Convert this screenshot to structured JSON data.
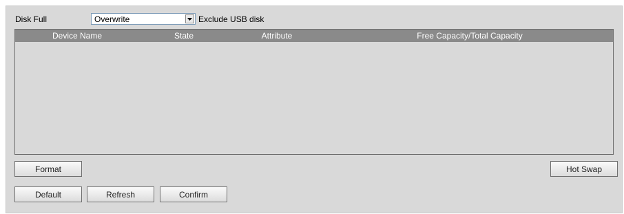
{
  "disk_full": {
    "label": "Disk Full",
    "select_value": "Overwrite",
    "exclude_label": "Exclude USB disk"
  },
  "table": {
    "columns": [
      "Device Name",
      "State",
      "Attribute",
      "Free Capacity/Total Capacity"
    ],
    "rows": []
  },
  "buttons": {
    "format": "Format",
    "hot_swap": "Hot Swap",
    "default": "Default",
    "refresh": "Refresh",
    "confirm": "Confirm"
  },
  "icons": {
    "select_arrow": "chevron-down-icon"
  }
}
